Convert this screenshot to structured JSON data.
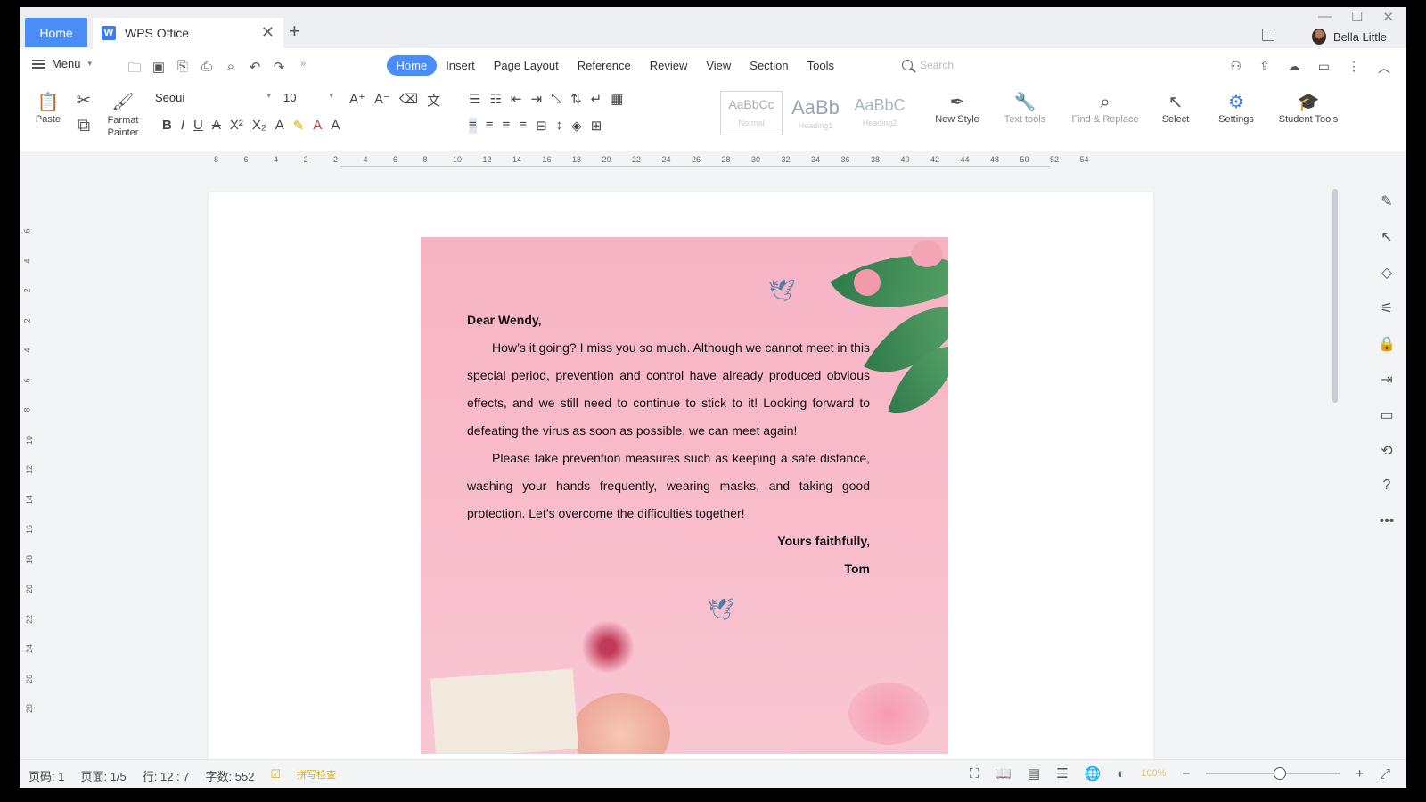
{
  "titlebar": {
    "home_tab": "Home",
    "doc_tab": "WPS Office",
    "doc_logo": "W",
    "close_glyph": "✕",
    "add_glyph": "+",
    "user_name": "Bella Little",
    "window_controls": [
      "—",
      "☐",
      "✕"
    ]
  },
  "menubar": {
    "menu_label": "Menu",
    "quick_icons": [
      "open-folder-icon",
      "save-icon",
      "export-icon",
      "print-icon",
      "preview-icon",
      "undo-icon",
      "redo-icon",
      "more-icon"
    ],
    "tabs": [
      {
        "label": "Home",
        "active": true
      },
      {
        "label": "Insert",
        "active": false
      },
      {
        "label": "Page Layout",
        "active": false
      },
      {
        "label": "Reference",
        "active": false
      },
      {
        "label": "Review",
        "active": false
      },
      {
        "label": "View",
        "active": false
      },
      {
        "label": "Section",
        "active": false
      },
      {
        "label": "Tools",
        "active": false
      }
    ],
    "search_placeholder": "Search"
  },
  "ribbon": {
    "paste": "Paste",
    "format_painter_1": "Farmat",
    "format_painter_2": "Painter",
    "font_name": "Seoui",
    "font_size": "10",
    "style_normal": "AaBbCc",
    "style_normal_name": "Normal",
    "style_h1": "AaBb",
    "style_h1_name": "Heading1",
    "style_h2": "AaBbC",
    "style_h2_name": "Heading2",
    "new_style": "New Style",
    "text_tools": "Text tools",
    "find_replace": "Find & Replace",
    "select": "Select",
    "settings": "Settings",
    "student_tools": "Student Tools",
    "accent": "#4a8df8"
  },
  "ruler": {
    "marks": [
      "8",
      "6",
      "4",
      "2",
      "2",
      "4",
      "6",
      "8",
      "10",
      "12",
      "14",
      "16",
      "18",
      "20",
      "22",
      "24",
      "26",
      "28",
      "30",
      "32",
      "34",
      "36",
      "38",
      "40",
      "42",
      "44",
      "48",
      "50",
      "52",
      "54"
    ],
    "vmarks": [
      "6",
      "4",
      "2",
      "2",
      "4",
      "6",
      "8",
      "10",
      "12",
      "14",
      "16",
      "18",
      "20",
      "22",
      "24",
      "26",
      "28"
    ]
  },
  "letter": {
    "salutation": "Dear Wendy,",
    "para1": "How’s it going? I miss you so much. Although we cannot meet in this special period, prevention and control have already produced obvious effects, and we still need to continue to stick to it! Looking forward to defeating the virus as soon as possible, we can meet again!",
    "para2": "Please take prevention measures such as keeping a safe distance, washing your hands frequently, wearing masks, and taking good protection. Let’s overcome the difficulties together!",
    "closing": "Yours faithfully,",
    "signature": "Tom",
    "background": "#f7b4c4"
  },
  "status": {
    "page_code": "页码: 1",
    "pages": "页面: 1/5",
    "line": "行: 12 : 7",
    "word_count": "字数: 552",
    "spell": "拼写检查",
    "zoom": "100%",
    "zoom_level": 0.55
  }
}
